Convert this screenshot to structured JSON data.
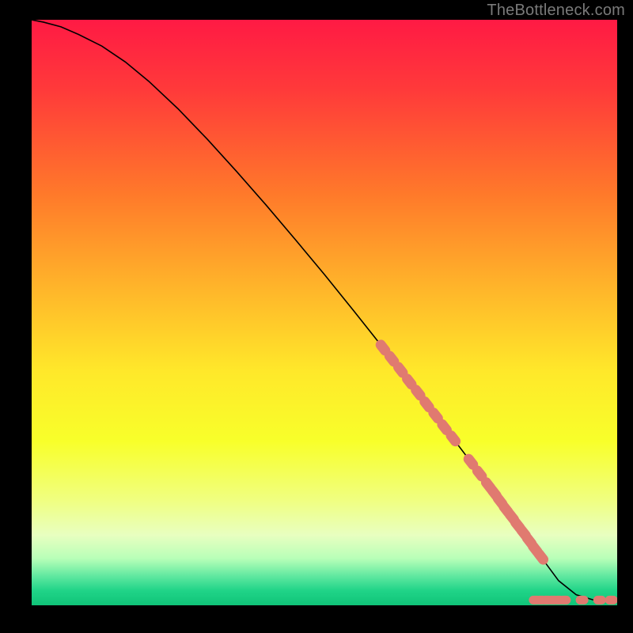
{
  "watermark": "TheBottleneck.com",
  "chart_data": {
    "type": "line",
    "title": "",
    "xlabel": "",
    "ylabel": "",
    "xlim": [
      0,
      100
    ],
    "ylim": [
      0,
      100
    ],
    "background_gradient": {
      "stops": [
        {
          "offset": 0.0,
          "color": "#ff1a44"
        },
        {
          "offset": 0.12,
          "color": "#ff3a3a"
        },
        {
          "offset": 0.3,
          "color": "#ff7a2a"
        },
        {
          "offset": 0.45,
          "color": "#ffb22a"
        },
        {
          "offset": 0.6,
          "color": "#ffe82a"
        },
        {
          "offset": 0.72,
          "color": "#f8ff2a"
        },
        {
          "offset": 0.82,
          "color": "#f0ff80"
        },
        {
          "offset": 0.88,
          "color": "#e8ffc0"
        },
        {
          "offset": 0.92,
          "color": "#b8ffb8"
        },
        {
          "offset": 0.95,
          "color": "#60e8a0"
        },
        {
          "offset": 0.975,
          "color": "#20d488"
        },
        {
          "offset": 1.0,
          "color": "#10c478"
        }
      ]
    },
    "curve": {
      "x": [
        0,
        2,
        5,
        8,
        12,
        16,
        20,
        25,
        30,
        35,
        40,
        45,
        50,
        55,
        60,
        65,
        70,
        75,
        80,
        83,
        85,
        88,
        90,
        93,
        96,
        100
      ],
      "y": [
        100,
        99.6,
        98.8,
        97.5,
        95.5,
        92.8,
        89.5,
        84.8,
        79.6,
        74.1,
        68.4,
        62.5,
        56.5,
        50.3,
        44.0,
        37.6,
        31.1,
        24.5,
        17.8,
        13.7,
        11.0,
        6.9,
        4.2,
        1.8,
        0.9,
        0.8
      ]
    },
    "marker_segment": {
      "color": "#e07a70",
      "points": [
        {
          "x": 60.0,
          "y": 44.0
        },
        {
          "x": 61.5,
          "y": 42.1
        },
        {
          "x": 63.0,
          "y": 40.2
        },
        {
          "x": 64.5,
          "y": 38.2
        },
        {
          "x": 66.0,
          "y": 36.3
        },
        {
          "x": 67.5,
          "y": 34.3
        },
        {
          "x": 69.0,
          "y": 32.4
        },
        {
          "x": 70.5,
          "y": 30.4
        },
        {
          "x": 72.0,
          "y": 28.5
        },
        {
          "x": 75.0,
          "y": 24.5
        },
        {
          "x": 76.5,
          "y": 22.5
        },
        {
          "x": 78.0,
          "y": 20.5
        },
        {
          "x": 79.0,
          "y": 19.2
        },
        {
          "x": 80.0,
          "y": 17.8
        },
        {
          "x": 81.0,
          "y": 16.4
        },
        {
          "x": 82.0,
          "y": 15.1
        },
        {
          "x": 83.0,
          "y": 13.7
        },
        {
          "x": 84.0,
          "y": 12.4
        },
        {
          "x": 85.0,
          "y": 11.0
        },
        {
          "x": 86.0,
          "y": 9.6
        },
        {
          "x": 87.0,
          "y": 8.3
        }
      ]
    },
    "baseline_markers": {
      "color": "#e07a70",
      "points": [
        {
          "x": 86.0,
          "y": 0.9
        },
        {
          "x": 87.0,
          "y": 0.9
        },
        {
          "x": 88.0,
          "y": 0.9
        },
        {
          "x": 89.0,
          "y": 0.9
        },
        {
          "x": 90.0,
          "y": 0.9
        },
        {
          "x": 91.0,
          "y": 0.9
        },
        {
          "x": 94.0,
          "y": 0.9
        },
        {
          "x": 97.0,
          "y": 0.9
        },
        {
          "x": 99.0,
          "y": 0.9
        }
      ]
    }
  }
}
